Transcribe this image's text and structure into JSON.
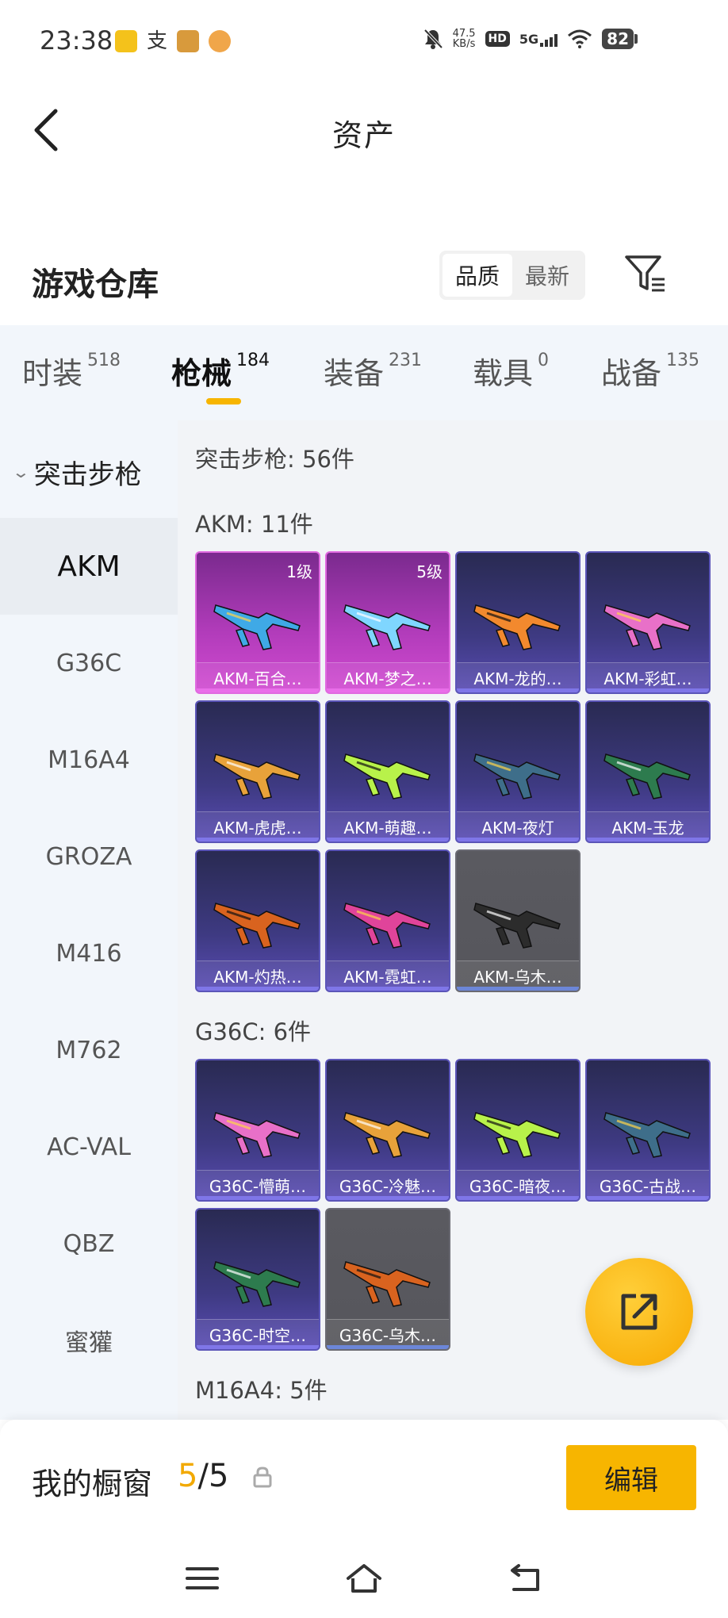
{
  "status": {
    "time": "23:38",
    "net_speed_value": "47.5",
    "net_speed_unit": "KB/s",
    "hd": "HD",
    "network": "5G",
    "battery": "82",
    "icons": [
      "app-notification-icon",
      "alipay-icon",
      "game-notification-icon",
      "app-notification-icon",
      "mute-icon",
      "wifi-icon",
      "signal-icon"
    ]
  },
  "header": {
    "title": "资产"
  },
  "section": {
    "title": "游戏仓库",
    "sort_options": [
      "品质",
      "最新"
    ],
    "active_sort": "品质"
  },
  "categories": [
    {
      "label": "时装",
      "count": "518"
    },
    {
      "label": "枪械",
      "count": "184"
    },
    {
      "label": "装备",
      "count": "231"
    },
    {
      "label": "载具",
      "count": "0"
    },
    {
      "label": "战备",
      "count": "135"
    }
  ],
  "active_category": "枪械",
  "sidebar": {
    "group": "突击步枪",
    "items": [
      "AKM",
      "G36C",
      "M16A4",
      "GROZA",
      "M416",
      "M762",
      "AC-VAL",
      "QBZ",
      "蜜獾"
    ],
    "active": "AKM"
  },
  "main": {
    "summary": "突击步枪: 56件",
    "groups": [
      {
        "label": "AKM: 11件",
        "items": [
          {
            "name": "AKM-百合…",
            "level": "1级",
            "rarity": "pink"
          },
          {
            "name": "AKM-梦之…",
            "level": "5级",
            "rarity": "pink"
          },
          {
            "name": "AKM-龙的…",
            "level": "",
            "rarity": "purple"
          },
          {
            "name": "AKM-彩虹…",
            "level": "",
            "rarity": "purple"
          },
          {
            "name": "AKM-虎虎…",
            "level": "",
            "rarity": "purple"
          },
          {
            "name": "AKM-萌趣…",
            "level": "",
            "rarity": "purple"
          },
          {
            "name": "AKM-夜灯",
            "level": "",
            "rarity": "purple"
          },
          {
            "name": "AKM-玉龙",
            "level": "",
            "rarity": "purple"
          },
          {
            "name": "AKM-灼热…",
            "level": "",
            "rarity": "purple"
          },
          {
            "name": "AKM-霓虹…",
            "level": "",
            "rarity": "purple"
          },
          {
            "name": "AKM-乌木…",
            "level": "",
            "rarity": "gray"
          }
        ]
      },
      {
        "label": "G36C: 6件",
        "items": [
          {
            "name": "G36C-懵萌…",
            "level": "",
            "rarity": "purple"
          },
          {
            "name": "G36C-冷魅…",
            "level": "",
            "rarity": "purple"
          },
          {
            "name": "G36C-暗夜…",
            "level": "",
            "rarity": "purple"
          },
          {
            "name": "G36C-古战…",
            "level": "",
            "rarity": "purple"
          },
          {
            "name": "G36C-时空…",
            "level": "",
            "rarity": "purple"
          },
          {
            "name": "G36C-乌木…",
            "level": "",
            "rarity": "gray"
          }
        ]
      },
      {
        "label": "M16A4: 5件",
        "items": []
      }
    ]
  },
  "colors": {
    "accent": "#f7b500",
    "pink_rarity": "#d24bd2",
    "purple_rarity": "#5a4cb4",
    "gray_rarity": "#56565c"
  },
  "showcase": {
    "label": "我的橱窗",
    "current": "5",
    "separator": "/",
    "total": "5",
    "edit_label": "编辑"
  }
}
